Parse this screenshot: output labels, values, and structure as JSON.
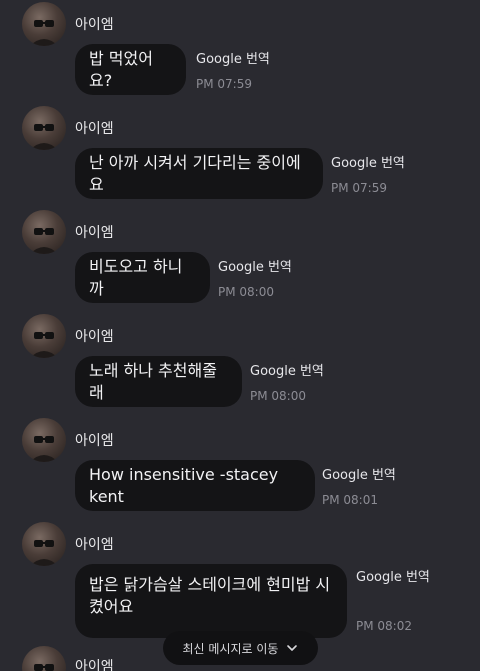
{
  "conversation": {
    "messages": [
      {
        "sender": "아이엠",
        "text": "밥 먹었어요?",
        "translate_label": "Google 번역",
        "time": "PM 07:59"
      },
      {
        "sender": "아이엠",
        "text": "난 아까 시켜서 기다리는 중이에요",
        "translate_label": "Google 번역",
        "time": "PM 07:59"
      },
      {
        "sender": "아이엠",
        "text": "비도오고 하니까",
        "translate_label": "Google 번역",
        "time": "PM 08:00"
      },
      {
        "sender": "아이엠",
        "text": "노래 하나 추천해줄래",
        "translate_label": "Google 번역",
        "time": "PM 08:00"
      },
      {
        "sender": "아이엠",
        "text": "How insensitive -stacey kent",
        "translate_label": "Google 번역",
        "time": "PM 08:01"
      },
      {
        "sender": "아이엠",
        "text_line1": "밥은 닭가슴살 스테이크에 현미밥 시",
        "text_line2": "켰어요",
        "translate_label": "Google 번역",
        "time": "PM 08:02"
      },
      {
        "sender": "아이엠"
      }
    ]
  },
  "scroll_button": {
    "label": "최신 메시지로 이동",
    "icon": "chevron-down-icon"
  },
  "colors": {
    "background": "#2a2a30",
    "bubble": "#141416",
    "timestamp": "#8c8c94"
  }
}
